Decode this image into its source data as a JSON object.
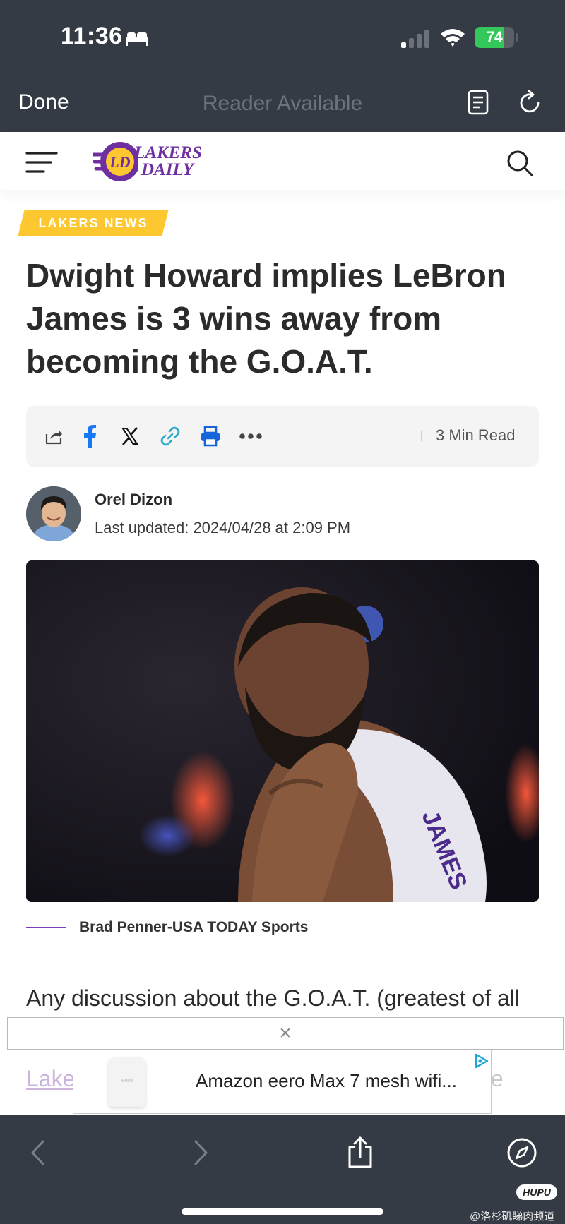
{
  "status_bar": {
    "time": "11:36",
    "battery": "74",
    "battery_level": 0.74,
    "icons": [
      "bed-icon",
      "signal-icon",
      "wifi-icon",
      "battery-icon"
    ]
  },
  "browser": {
    "done_label": "Done",
    "reader_label": "Reader Available",
    "icons": [
      "reader-icon",
      "reload-icon"
    ]
  },
  "site": {
    "logo_line1": "LAKERS",
    "logo_line2": "DAILY",
    "icons": [
      "menu-icon",
      "search-icon"
    ]
  },
  "article": {
    "category": "LAKERS NEWS",
    "title": "Dwight Howard implies LeBron James is 3 wins away from becoming the G.O.A.T.",
    "read_time": "3 Min Read",
    "author": "Orel Dizon",
    "updated": "Last updated: 2024/04/28 at 2:09 PM",
    "image_caption": "Brad Penner-USA TODAY Sports",
    "body_first_line": "Any discussion about the G.O.A.T. (greatest of all",
    "body_partial_link": "Lake",
    "body_partial_end": "e"
  },
  "share_icons": [
    "share-icon",
    "facebook-icon",
    "x-icon",
    "link-icon",
    "print-icon",
    "more-icon"
  ],
  "colors": {
    "chrome": "#343b44",
    "accent_purple": "#6f2fa0",
    "accent_gold": "#fdc82f",
    "facebook": "#1877f2",
    "link": "#2aa8c7",
    "print": "#1565d8"
  },
  "ad": {
    "close_symbol": "×",
    "title": "Amazon eero Max 7 mesh wifi...",
    "product_text": "eero"
  },
  "toolbar": {
    "icons": [
      "back-icon",
      "forward-icon",
      "share-sheet-icon",
      "compass-icon"
    ]
  },
  "watermark": {
    "badge": "HUPU",
    "text": "@洛杉矶睇肉频道"
  }
}
